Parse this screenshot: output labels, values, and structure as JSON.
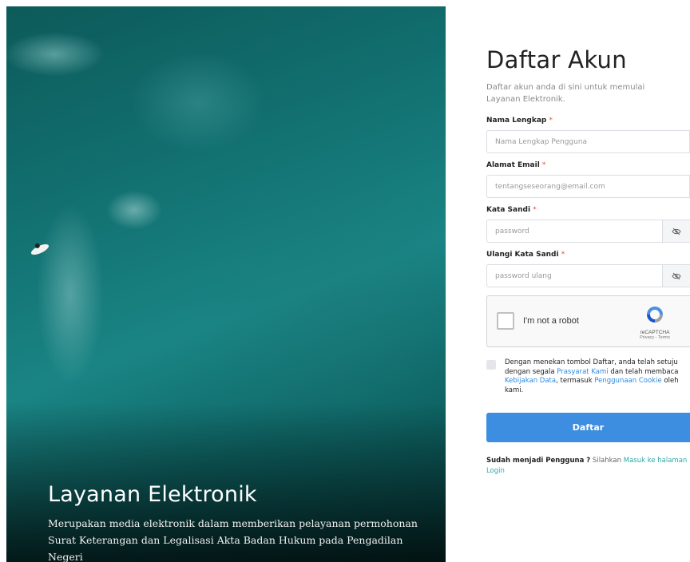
{
  "hero": {
    "title": "Layanan Elektronik",
    "description": "Merupakan media elektronik dalam memberikan pelayanan permohonan Surat Keterangan dan Legalisasi Akta Badan Hukum pada Pengadilan Negeri"
  },
  "form": {
    "title": "Daftar Akun",
    "subtitle": "Daftar akun anda di sini untuk memulai Layanan Elektronik.",
    "required_mark": "*",
    "fields": {
      "name": {
        "label": "Nama Lengkap",
        "placeholder": "Nama Lengkap Pengguna",
        "value": ""
      },
      "email": {
        "label": "Alamat Email",
        "placeholder": "tentangseseorang@email.com",
        "value": ""
      },
      "password": {
        "label": "Kata Sandi",
        "placeholder": "password",
        "value": "",
        "toggle_icon": "eye-slash-icon"
      },
      "password_confirm": {
        "label": "Ulangi Kata Sandi",
        "placeholder": "password ulang",
        "value": "",
        "toggle_icon": "eye-slash-icon"
      }
    },
    "captcha": {
      "label": "I'm not a robot",
      "brand": "reCAPTCHA",
      "privacy": "Privacy",
      "separator": " - ",
      "terms": "Terms"
    },
    "consent": {
      "part1": "Dengan menekan tombol Daftar, anda telah setuju dengan segala ",
      "link1": "Prasyarat Kami",
      "part2": " dan telah membaca ",
      "link2": "Kebijakan Data",
      "part3": ", termasuk ",
      "link3": "Penggunaan Cookie",
      "part4": " oleh kami."
    },
    "submit_label": "Daftar",
    "login": {
      "prefix": "Sudah menjadi Pengguna ?",
      "middle": " Silahkan ",
      "link": "Masuk ke halaman Login"
    }
  },
  "colors": {
    "accent": "#3d8ee0",
    "link": "#2d8be0",
    "required": "#e74c3c",
    "hero_water": "#127070"
  }
}
